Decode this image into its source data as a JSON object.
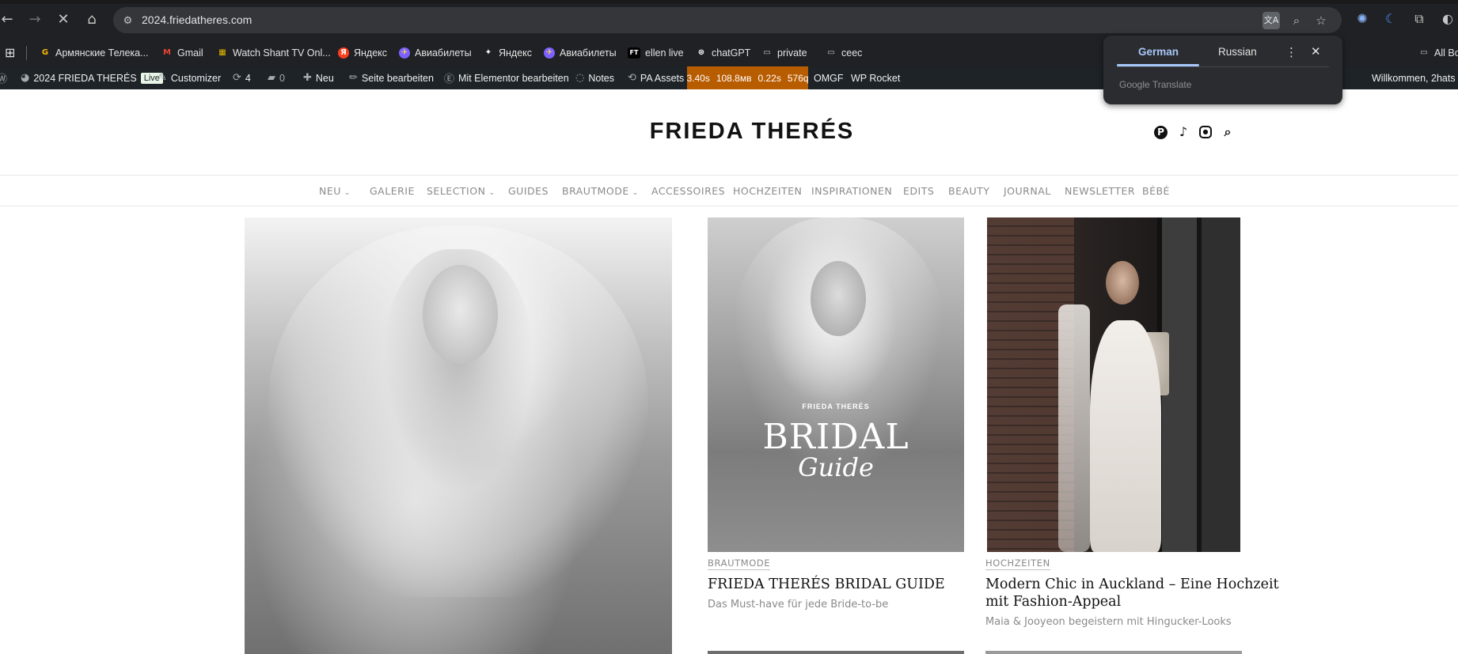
{
  "browser": {
    "url": "2024.friedatheres.com",
    "nav": {
      "back": "←",
      "forward": "→",
      "reload_stop": "✕",
      "home": "⌂"
    },
    "bookmarks": [
      {
        "label": "Армянские Телека...",
        "icon": "G"
      },
      {
        "label": "Gmail",
        "icon": "M"
      },
      {
        "label": "Watch Shant TV Onl...",
        "icon": "▦"
      },
      {
        "label": "Яндекс",
        "icon": "Я"
      },
      {
        "label": "Авиабилеты",
        "icon": "✈"
      },
      {
        "label": "Яндекс",
        "icon": "✦"
      },
      {
        "label": "Авиабилеты",
        "icon": "✈"
      },
      {
        "label": "ellen live",
        "icon": "FT"
      },
      {
        "label": "chatGPT",
        "icon": "⊛"
      },
      {
        "label": "private",
        "icon": "▭"
      },
      {
        "label": "ceec",
        "icon": "▭"
      }
    ],
    "all_bookmarks": "All Bo"
  },
  "wp_admin_bar": {
    "site": "2024 FRIEDA THERÉS",
    "live": "Live",
    "customizer": "Customizer",
    "updates": "4",
    "comments": "0",
    "new": "Neu",
    "edit_page": "Seite bearbeiten",
    "elementor": "Mit Elementor bearbeiten",
    "notes": "Notes",
    "pa_assets": "PA Assets",
    "query_monitor": [
      "3.40s",
      "108.8мв",
      "0.22s",
      "576q"
    ],
    "omgf": "OMGF",
    "wp_rocket": "WP Rocket",
    "welcome": "Willkommen, 2hats"
  },
  "translate_popup": {
    "tab_source": "German",
    "tab_target": "Russian",
    "brand": "Google Translate"
  },
  "site": {
    "title": "FRIEDA THERÉS",
    "nav": [
      {
        "label": "NEU",
        "has_dropdown": true
      },
      {
        "label": "GALERIE",
        "has_dropdown": false
      },
      {
        "label": "SELECTION",
        "has_dropdown": true
      },
      {
        "label": "GUIDES",
        "has_dropdown": false
      },
      {
        "label": "BRAUTMODE",
        "has_dropdown": true
      },
      {
        "label": "ACCESSOIRES",
        "has_dropdown": false
      },
      {
        "label": "HOCHZEITEN",
        "has_dropdown": false
      },
      {
        "label": "INSPIRATIONEN",
        "has_dropdown": false
      },
      {
        "label": "EDITS",
        "has_dropdown": false
      },
      {
        "label": "BEAUTY",
        "has_dropdown": false
      },
      {
        "label": "JOURNAL",
        "has_dropdown": false
      },
      {
        "label": "NEWSLETTER",
        "has_dropdown": false
      },
      {
        "label": "BÉBÉ",
        "has_dropdown": false
      }
    ],
    "nav_chevron": "⌄"
  },
  "posts": [
    {
      "category": "BRAUTMODE",
      "title": "FRIEDA THERÉS BRIDAL GUIDE",
      "subtitle": "Das Must-have für jede Bride-to-be",
      "image_text": {
        "small": "FRIEDA THERÉS",
        "big": "BRIDAL",
        "script": "Guide"
      }
    },
    {
      "category": "HOCHZEITEN",
      "title_line1": "Modern Chic in Auckland – Eine Hochzeit",
      "title_line2": "mit Fashion-Appeal",
      "subtitle": "Maia & Jooyeon begeistern mit Hingucker-Looks"
    }
  ],
  "colors": {
    "chrome_bg": "#202124",
    "wp_bar_bg": "#1d2327",
    "query_monitor_bg": "#b85c00",
    "translate_accent": "#a8c7fa",
    "nav_text": "#8a8a8a"
  }
}
